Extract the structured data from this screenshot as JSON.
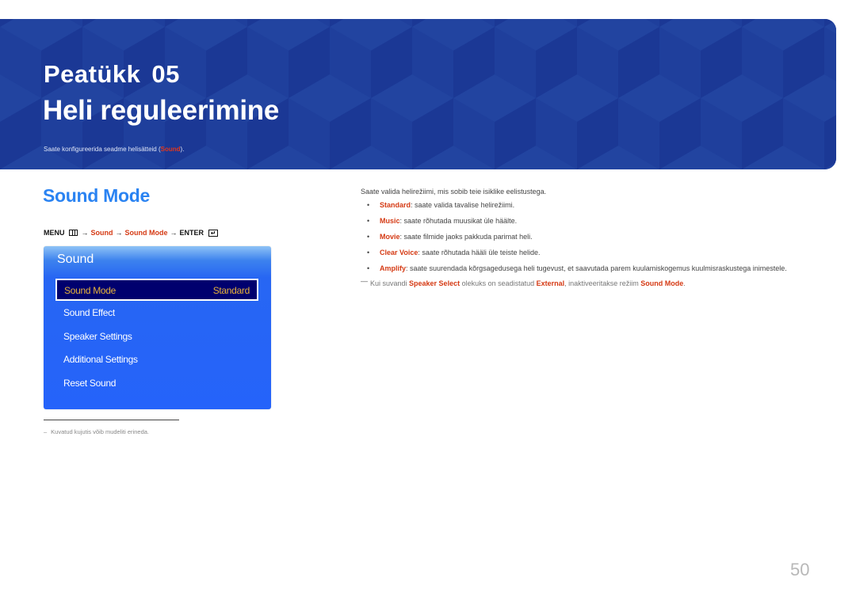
{
  "banner": {
    "chapter_label": "Peatükk",
    "chapter_number": "05",
    "title": "Heli reguleerimine",
    "description_prefix": "Saate konfigureerida seadme helisätteid (",
    "description_highlight": "Sound",
    "description_suffix": ")."
  },
  "section": {
    "title": "Sound Mode"
  },
  "menu_path": {
    "menu": "MENU",
    "menu_icon": "menu-grid-icon",
    "arrow": "→",
    "step1": "Sound",
    "step2": "Sound Mode",
    "enter": "ENTER",
    "enter_icon": "enter-icon",
    "enter_glyph": "↵"
  },
  "osd": {
    "title": "Sound",
    "selected_item": {
      "label": "Sound Mode",
      "value": "Standard"
    },
    "items": [
      {
        "label": "Sound Effect"
      },
      {
        "label": "Speaker Settings"
      },
      {
        "label": "Additional Settings"
      },
      {
        "label": "Reset Sound"
      }
    ]
  },
  "footnote": {
    "dash": "–",
    "text": "Kuvatud kujutis võib mudeliti erineda."
  },
  "content": {
    "intro": "Saate valida helirežiimi, mis sobib teie isiklike eelistustega.",
    "bullet_glyph": "•",
    "bullets": [
      {
        "term": "Standard",
        "text": ": saate valida tavalise helirežiimi."
      },
      {
        "term": "Music",
        "text": ": saate rõhutada muusikat üle häälte."
      },
      {
        "term": "Movie",
        "text": ": saate filmide jaoks pakkuda parimat heli."
      },
      {
        "term": "Clear Voice",
        "text": ": saate rõhutada hääli üle teiste helide."
      },
      {
        "term": "Amplify",
        "text": ": saate suurendada kõrgsagedusega heli tugevust, et saavutada parem kuulamiskogemus kuulmisraskustega inimestele."
      }
    ],
    "note": {
      "dash": "―",
      "part1": "Kui suvandi ",
      "term1": "Speaker Select",
      "part2": " olekuks on seadistatud ",
      "term2": "External",
      "part3": ", inaktiveeritakse režiim ",
      "term3": "Sound Mode",
      "part4": "."
    }
  },
  "page_number": "50",
  "colors": {
    "banner_blue": "#1f3f9c",
    "heading_blue": "#2a83f2",
    "highlight_red": "#d53a14",
    "osd_blue": "#2563fa",
    "osd_selected_bg": "#00006e",
    "osd_selected_text": "#e7b23a"
  }
}
